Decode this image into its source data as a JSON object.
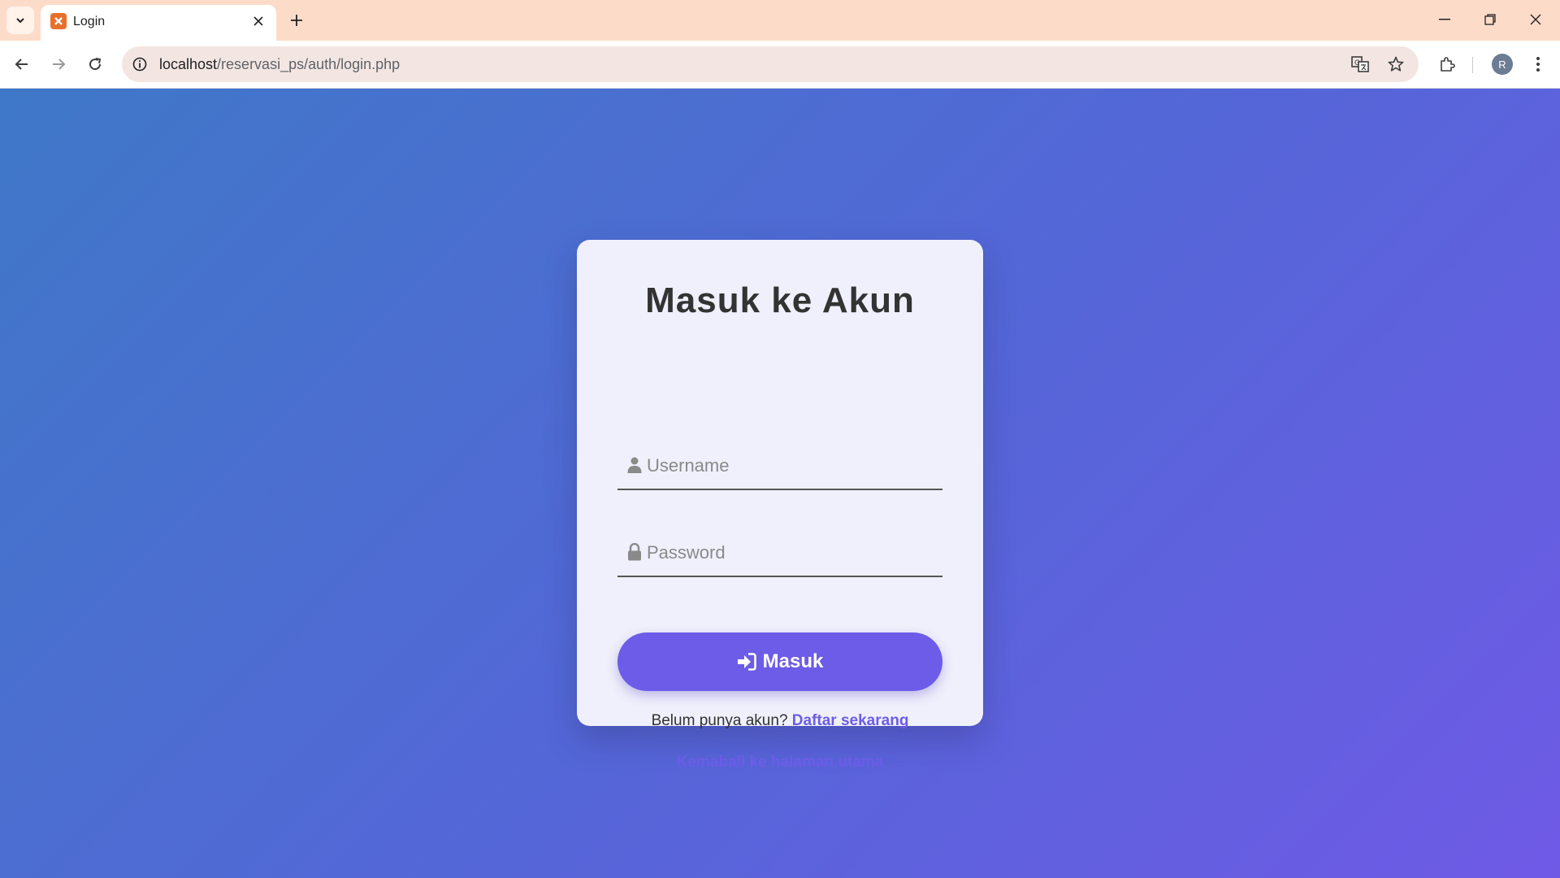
{
  "browser": {
    "tab_title": "Login",
    "url_host": "localhost",
    "url_path": "/reservasi_ps/auth/login.php",
    "profile_initial": "R",
    "icons": [
      "tab-search-icon",
      "close-icon",
      "plus-icon",
      "minimize-icon",
      "restore-icon",
      "close-window-icon",
      "back-icon",
      "forward-icon",
      "reload-icon",
      "info-icon",
      "translate-icon",
      "star-icon",
      "extensions-icon",
      "more-icon"
    ]
  },
  "login": {
    "title": "Masuk ke Akun",
    "username_placeholder": "Username",
    "password_placeholder": "Password",
    "submit_label": "Masuk",
    "register_prompt": "Belum punya akun?",
    "register_link": "Daftar sekarang",
    "back_link": "Kemabali ke halaman utama"
  },
  "colors": {
    "accent": "#6c5ce7",
    "card_bg": "#eff0fb",
    "gradient_start": "#3f78c8",
    "gradient_end": "#6f5ae6"
  }
}
